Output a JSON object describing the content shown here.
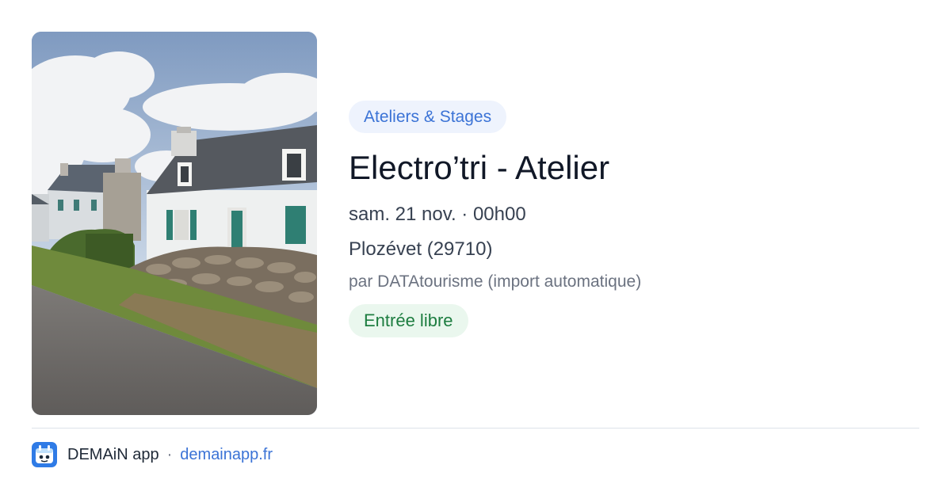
{
  "event": {
    "category": "Ateliers & Stages",
    "title": "Electro’tri - Atelier",
    "datetime": "sam. 21 nov. · 00h00",
    "location": "Plozévet (29710)",
    "author": "par DATAtourisme (import automatique)",
    "price": "Entrée libre",
    "image_alt": "Maisons bretonnes au bord d’une route"
  },
  "footer": {
    "app_icon": "demain-app-icon",
    "app_name": "DEMAiN app",
    "separator": "·",
    "site": "demainapp.fr"
  },
  "colors": {
    "category_text": "#3b73d6",
    "category_bg": "#eef3fd",
    "price_text": "#1d7d40",
    "price_bg": "#eaf7ee",
    "link": "#3b73d6",
    "title": "#111827"
  }
}
